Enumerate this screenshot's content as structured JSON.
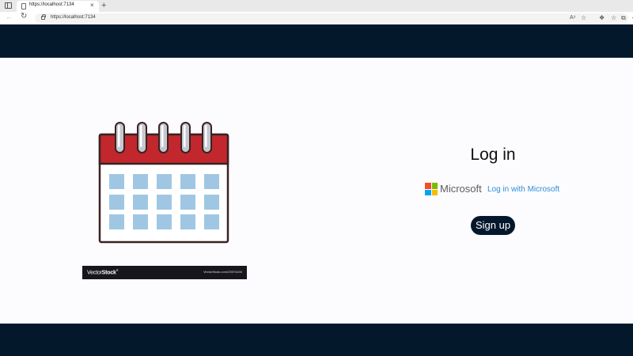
{
  "browser": {
    "tab_title": "https://localhost:7134",
    "tab_close": "×",
    "new_tab": "+",
    "url": "https://localhost:7134",
    "icons": [
      "tab-actions-icon",
      "page-icon",
      "back-icon",
      "reload-icon",
      "lock-icon",
      "read-aloud-icon",
      "favorite-icon",
      "extensions-icon",
      "favorites-icon",
      "collections-icon",
      "more-icon"
    ]
  },
  "page": {
    "header_color": "#04182c",
    "body_color": "#fcfbfe",
    "watermark": {
      "brand_prefix": "Vector",
      "brand_suffix": "Stock",
      "brand_mark": "®",
      "url": "VectorStock.com/23974430"
    },
    "login": {
      "title": "Log in",
      "microsoft_label": "Microsoft",
      "microsoft_link": "Log in with Microsoft",
      "signup_label": "Sign up",
      "link_color": "#2f8fd6"
    },
    "calendar_colors": {
      "top": "#c1272d",
      "cells": "#9fc7e3",
      "rings": "#c5c9cf",
      "outline": "#3a2222"
    }
  }
}
